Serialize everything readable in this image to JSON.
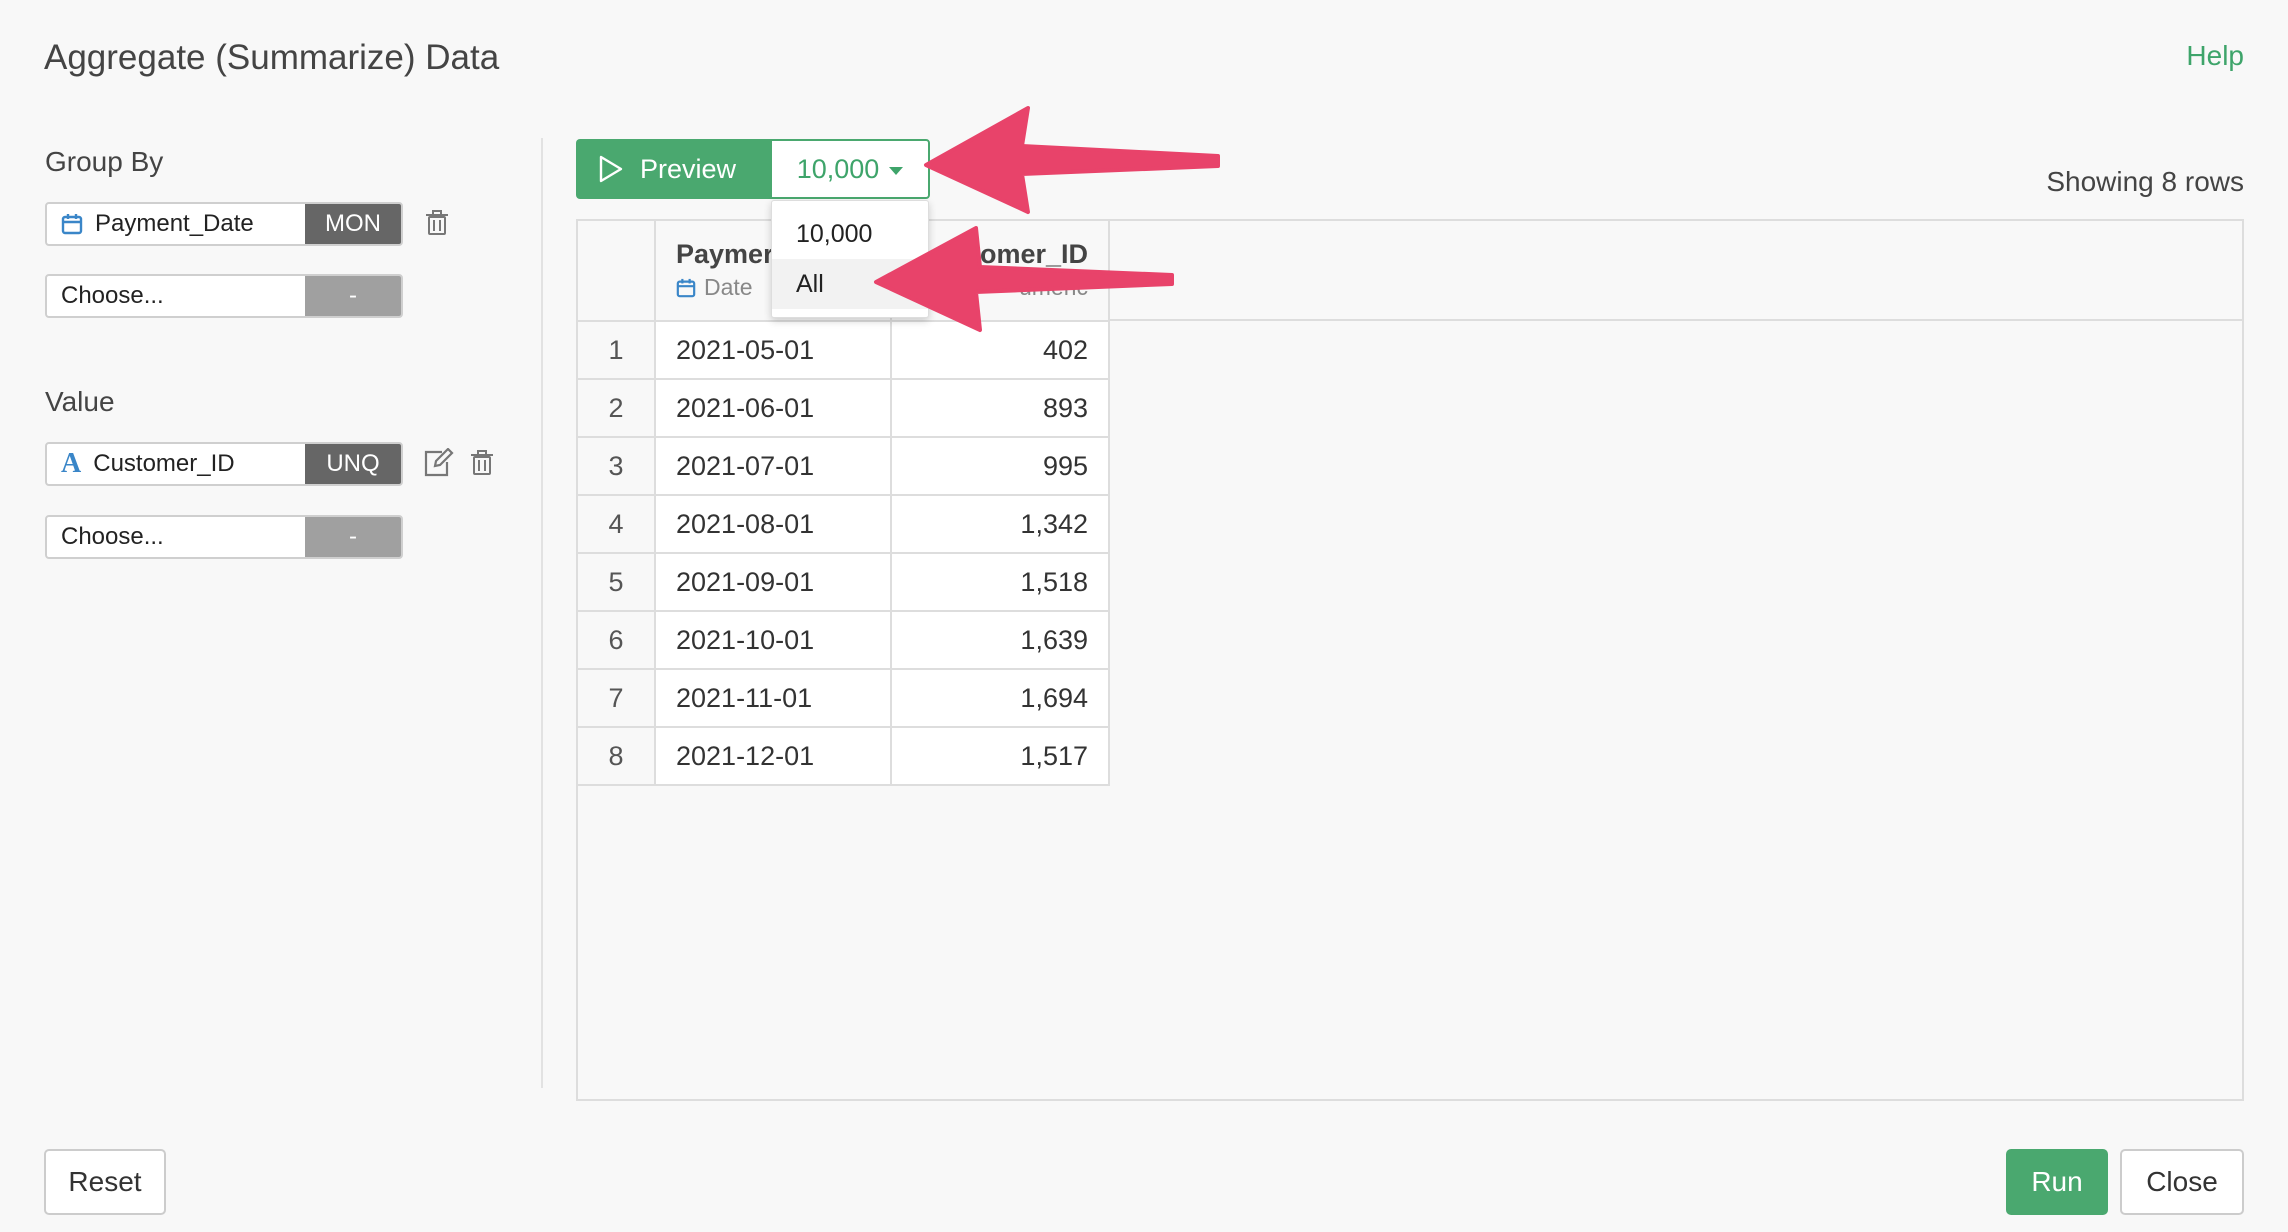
{
  "dialog": {
    "title": "Aggregate (Summarize) Data",
    "help_label": "Help"
  },
  "group_by": {
    "label": "Group By",
    "fields": [
      {
        "name": "Payment_Date",
        "icon": "calendar-icon",
        "agg": "MON"
      },
      {
        "name": "Choose...",
        "icon": "",
        "agg": "-"
      }
    ]
  },
  "value": {
    "label": "Value",
    "fields": [
      {
        "name": "Customer_ID",
        "icon": "character-type-icon",
        "agg": "UNQ"
      },
      {
        "name": "Choose...",
        "icon": "",
        "agg": "-"
      }
    ]
  },
  "preview": {
    "button_label": "Preview",
    "rows_selected": "10,000",
    "rows_options": [
      "10,000",
      "All"
    ],
    "showing_text": "Showing 8 rows"
  },
  "table": {
    "columns": [
      {
        "name": "Paymer",
        "type": "Date",
        "type_icon": "calendar-icon"
      },
      {
        "name": "omer_ID",
        "type": "umeric"
      }
    ],
    "rows": [
      {
        "index": "1",
        "date": "2021-05-01",
        "value": "402"
      },
      {
        "index": "2",
        "date": "2021-06-01",
        "value": "893"
      },
      {
        "index": "3",
        "date": "2021-07-01",
        "value": "995"
      },
      {
        "index": "4",
        "date": "2021-08-01",
        "value": "1,342"
      },
      {
        "index": "5",
        "date": "2021-09-01",
        "value": "1,518"
      },
      {
        "index": "6",
        "date": "2021-10-01",
        "value": "1,639"
      },
      {
        "index": "7",
        "date": "2021-11-01",
        "value": "1,694"
      },
      {
        "index": "8",
        "date": "2021-12-01",
        "value": "1,517"
      }
    ]
  },
  "footer": {
    "reset_label": "Reset",
    "run_label": "Run",
    "close_label": "Close"
  },
  "colors": {
    "accent": "#4aa86f",
    "annotation_arrow": "#e8436a",
    "agg_badge": "#666666"
  }
}
